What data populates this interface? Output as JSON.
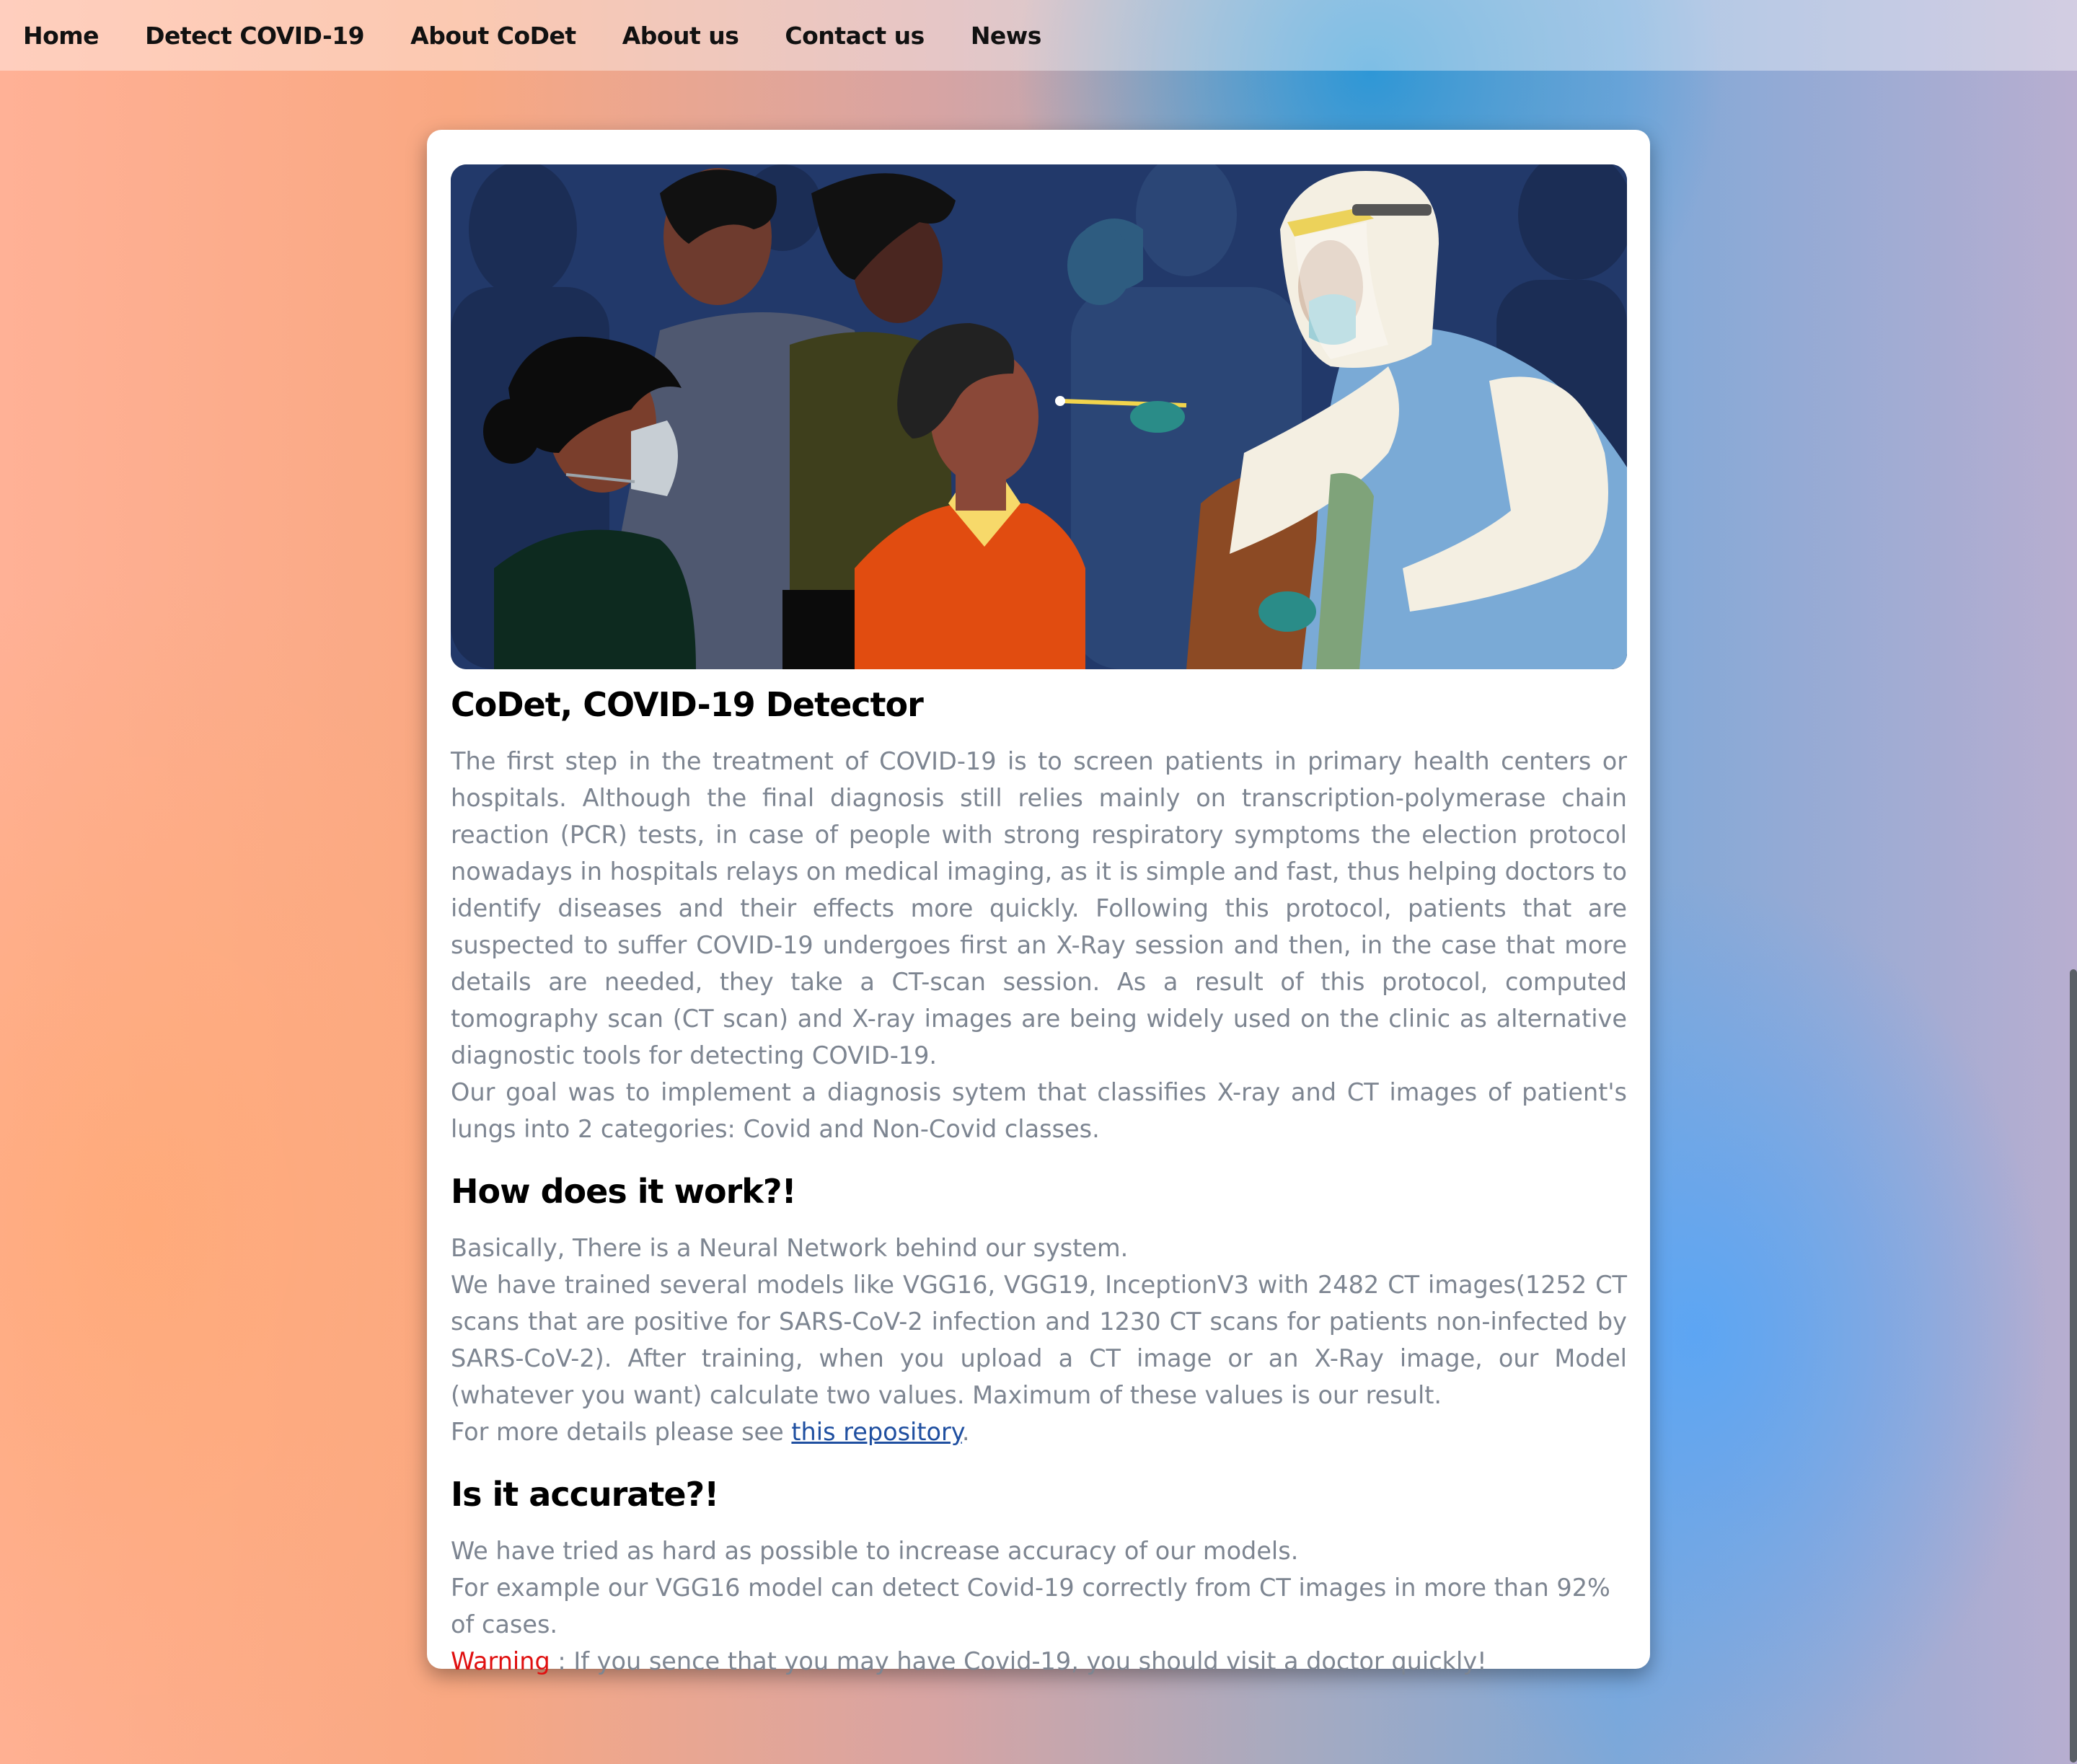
{
  "nav": {
    "items": [
      {
        "label": "Home"
      },
      {
        "label": "Detect COVID-19"
      },
      {
        "label": "About CoDet"
      },
      {
        "label": "About us"
      },
      {
        "label": "Contact us"
      },
      {
        "label": "News"
      }
    ]
  },
  "hero": {
    "icon": "covid-test-illustration"
  },
  "intro": {
    "title": "CoDet, COVID-19 Detector",
    "para1": "The first step in the treatment of COVID-19 is to screen patients in primary health centers or hospitals. Although the final diagnosis still relies mainly on transcription-polymerase chain reaction (PCR) tests, in case of people with strong respiratory symptoms the election protocol nowadays in hospitals relays on medical imaging, as it is simple and fast, thus helping doctors to identify diseases and their effects more quickly. Following this protocol, patients that are suspected to suffer COVID-19 undergoes first an X-Ray session and then, in the case that more details are needed, they take a CT-scan session. As a result of this protocol, computed tomography scan (CT scan) and X-ray images are being widely used on the clinic as alternative diagnostic tools for detecting COVID-19.",
    "para2": "Our goal was to implement a diagnosis sytem that classifies X-ray and CT images of patient's lungs into 2 categories: Covid and Non-Covid classes."
  },
  "how": {
    "title": "How does it work?!",
    "line1": "Basically, There is a Neural Network behind our system.",
    "line2": "We have trained several models like VGG16, VGG19, InceptionV3 with 2482 CT images(1252 CT scans that are positive for SARS-CoV-2 infection and 1230 CT scans for patients non-infected by SARS-CoV-2). After training, when you upload a CT image or an X-Ray image, our Model (whatever you want) calculate two values. Maximum of these values is our result.",
    "more_prefix": "For more details please see ",
    "link_text": "this repository",
    "more_suffix": "."
  },
  "accuracy": {
    "title": "Is it accurate?!",
    "line1": "We have tried as hard as possible to increase accuracy of our models.",
    "line2": "For example our VGG16 model can detect Covid-19 correctly from CT images in more than 92% of cases.",
    "warning_label": "Warning",
    "warning_text": " : If you sence that you may have Covid-19, you should visit a doctor quickly!"
  },
  "colors": {
    "warning": "#e01010",
    "link": "#1f4fa0",
    "body_text": "#7d8591"
  }
}
